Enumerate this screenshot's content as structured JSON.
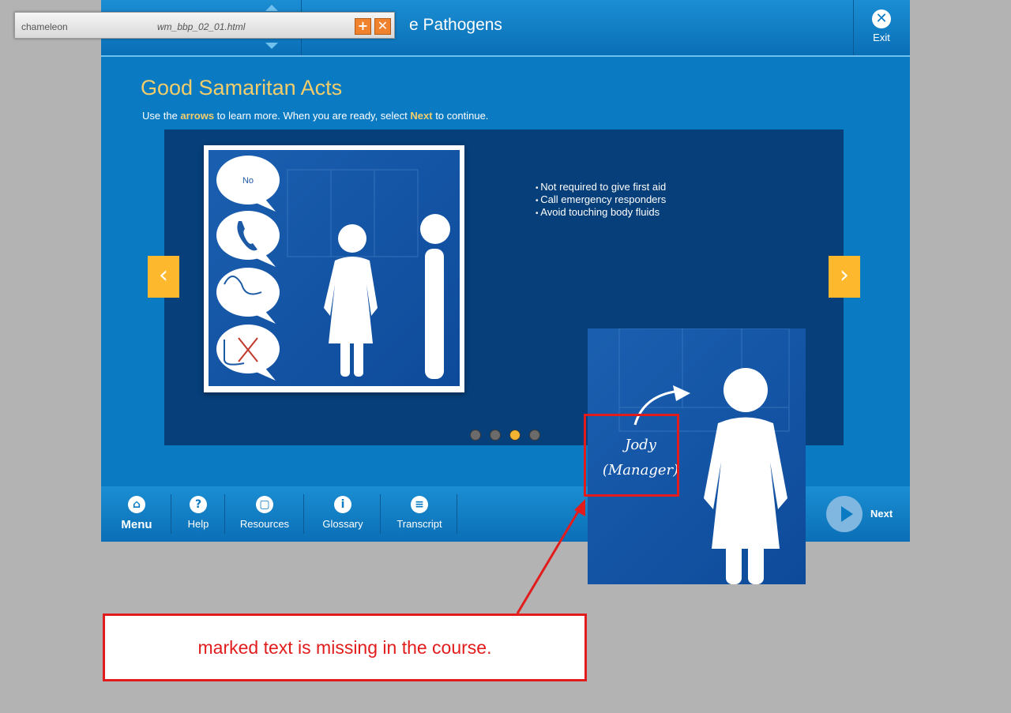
{
  "toolbar": {
    "logo": "chameleon",
    "filename": "wm_bbp_02_01.html",
    "add_icon": "plus-icon",
    "close_icon": "close-icon"
  },
  "header": {
    "course_title": "e Pathogens",
    "exit_label": "Exit",
    "exit_icon": "close-icon"
  },
  "page": {
    "title": "Good Samaritan Acts",
    "instructions": {
      "pre": "Use the ",
      "bold1": "arrows",
      "mid": " to learn more.  When you are ready, select ",
      "bold2": "Next",
      "post": " to continue."
    }
  },
  "slide": {
    "bubble_text": "No",
    "bullets": [
      "Not required to give first aid",
      "Call emergency responders",
      "Avoid touching body fluids"
    ],
    "total_dots": 4,
    "active_dot": 3,
    "prev_icon": "chevron-left-icon",
    "next_icon": "chevron-right-icon"
  },
  "footer": {
    "nav": [
      {
        "label": "Menu",
        "icon": "home-icon",
        "bold": true
      },
      {
        "label": "Help",
        "icon": "help-icon"
      },
      {
        "label": "Resources",
        "icon": "document-icon"
      },
      {
        "label": "Glossary",
        "icon": "info-icon"
      },
      {
        "label": "Transcript",
        "icon": "list-icon"
      }
    ],
    "next_label": "Next",
    "next_icon": "play-icon"
  },
  "zoom": {
    "name_line1": "Jody",
    "name_line2": "(Manager)"
  },
  "annotation": {
    "callout_text": "marked text is missing in the course."
  },
  "colors": {
    "course_blue": "#0a7bc3",
    "slide_dark": "#063f79",
    "accent_yellow": "#fdb82e",
    "title_gold": "#f3cd6a",
    "annotation_red": "#e21c1c"
  }
}
